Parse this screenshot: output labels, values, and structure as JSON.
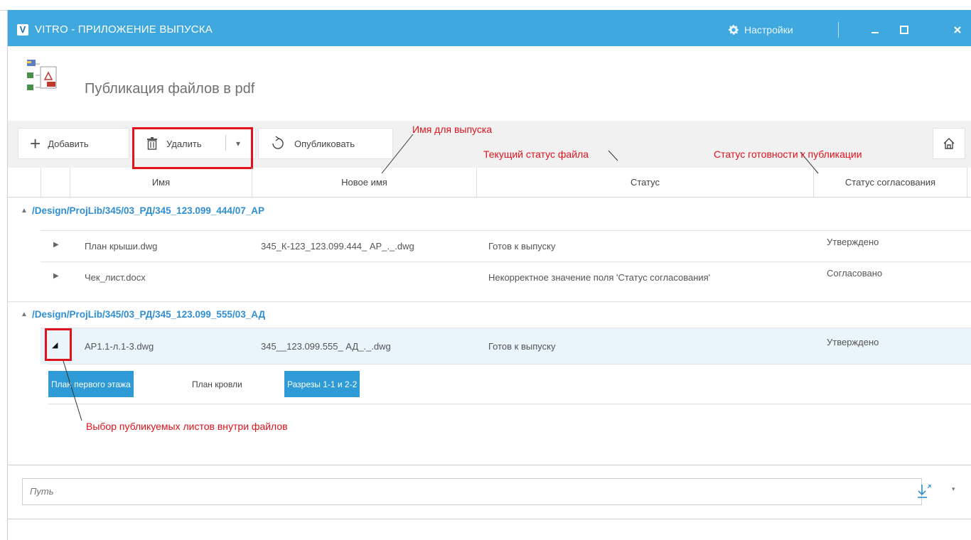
{
  "window": {
    "logo_letter": "V",
    "title": "VITRO - ПРИЛОЖЕНИЕ ВЫПУСКА",
    "settings_label": "Настройки",
    "min_glyph": "▁",
    "max_glyph": "□",
    "close_glyph": "✕"
  },
  "header": {
    "title": "Публикация файлов в pdf"
  },
  "toolbar": {
    "add_label": "Добавить",
    "delete_label": "Удалить",
    "publish_label": "Опубликовать",
    "add_glyph": "+",
    "dropdown_glyph": "▾"
  },
  "columns": {
    "name": "Имя",
    "new_name": "Новое имя",
    "status": "Статус",
    "approval": "Статус согласования"
  },
  "groups": [
    {
      "path": "/Design/ProjLib/345/03_РД/345_123.099_444/07_АР",
      "expanded_glyph": "▲",
      "files": [
        {
          "name": "План крыши.dwg",
          "new_name": "345_К-123_123.099.444_ АР_._.dwg",
          "status": "Готов к выпуску",
          "approval": "Утверждено",
          "expander": "▶"
        },
        {
          "name": "Чек_лист.docx",
          "new_name": "",
          "status": "Некорректное значение поля 'Статус согласования'",
          "approval": "Согласовано",
          "expander": "▶"
        }
      ]
    },
    {
      "path": "/Design/ProjLib/345/03_РД/345_123.099_555/03_АД",
      "expanded_glyph": "▲",
      "files": [
        {
          "name": "АР1.1-л.1-3.dwg",
          "new_name": "345__123.099.555_ АД_._.dwg",
          "status": "Готов к выпуску",
          "approval": "Утверждено",
          "expander": "◢"
        }
      ],
      "sheets": [
        {
          "label": "План первого этажа",
          "selected": true
        },
        {
          "label": "План кровли",
          "selected": false
        },
        {
          "label": "Разрезы 1-1 и 2-2",
          "selected": true
        }
      ]
    }
  ],
  "annotations": {
    "release_name": "Имя для выпуска",
    "current_status": "Текущий статус файла",
    "readiness_status": "Статус готовности к публикации",
    "sheet_selection": "Выбор публикуемых листов внутри файлов"
  },
  "path_field": {
    "placeholder": "Путь",
    "dropdown_glyph": "▾"
  },
  "colors": {
    "titlebar": "#3fa9df",
    "accent": "#2e9bd6",
    "highlight": "#e0121b",
    "group_path": "#2e8fd4"
  }
}
